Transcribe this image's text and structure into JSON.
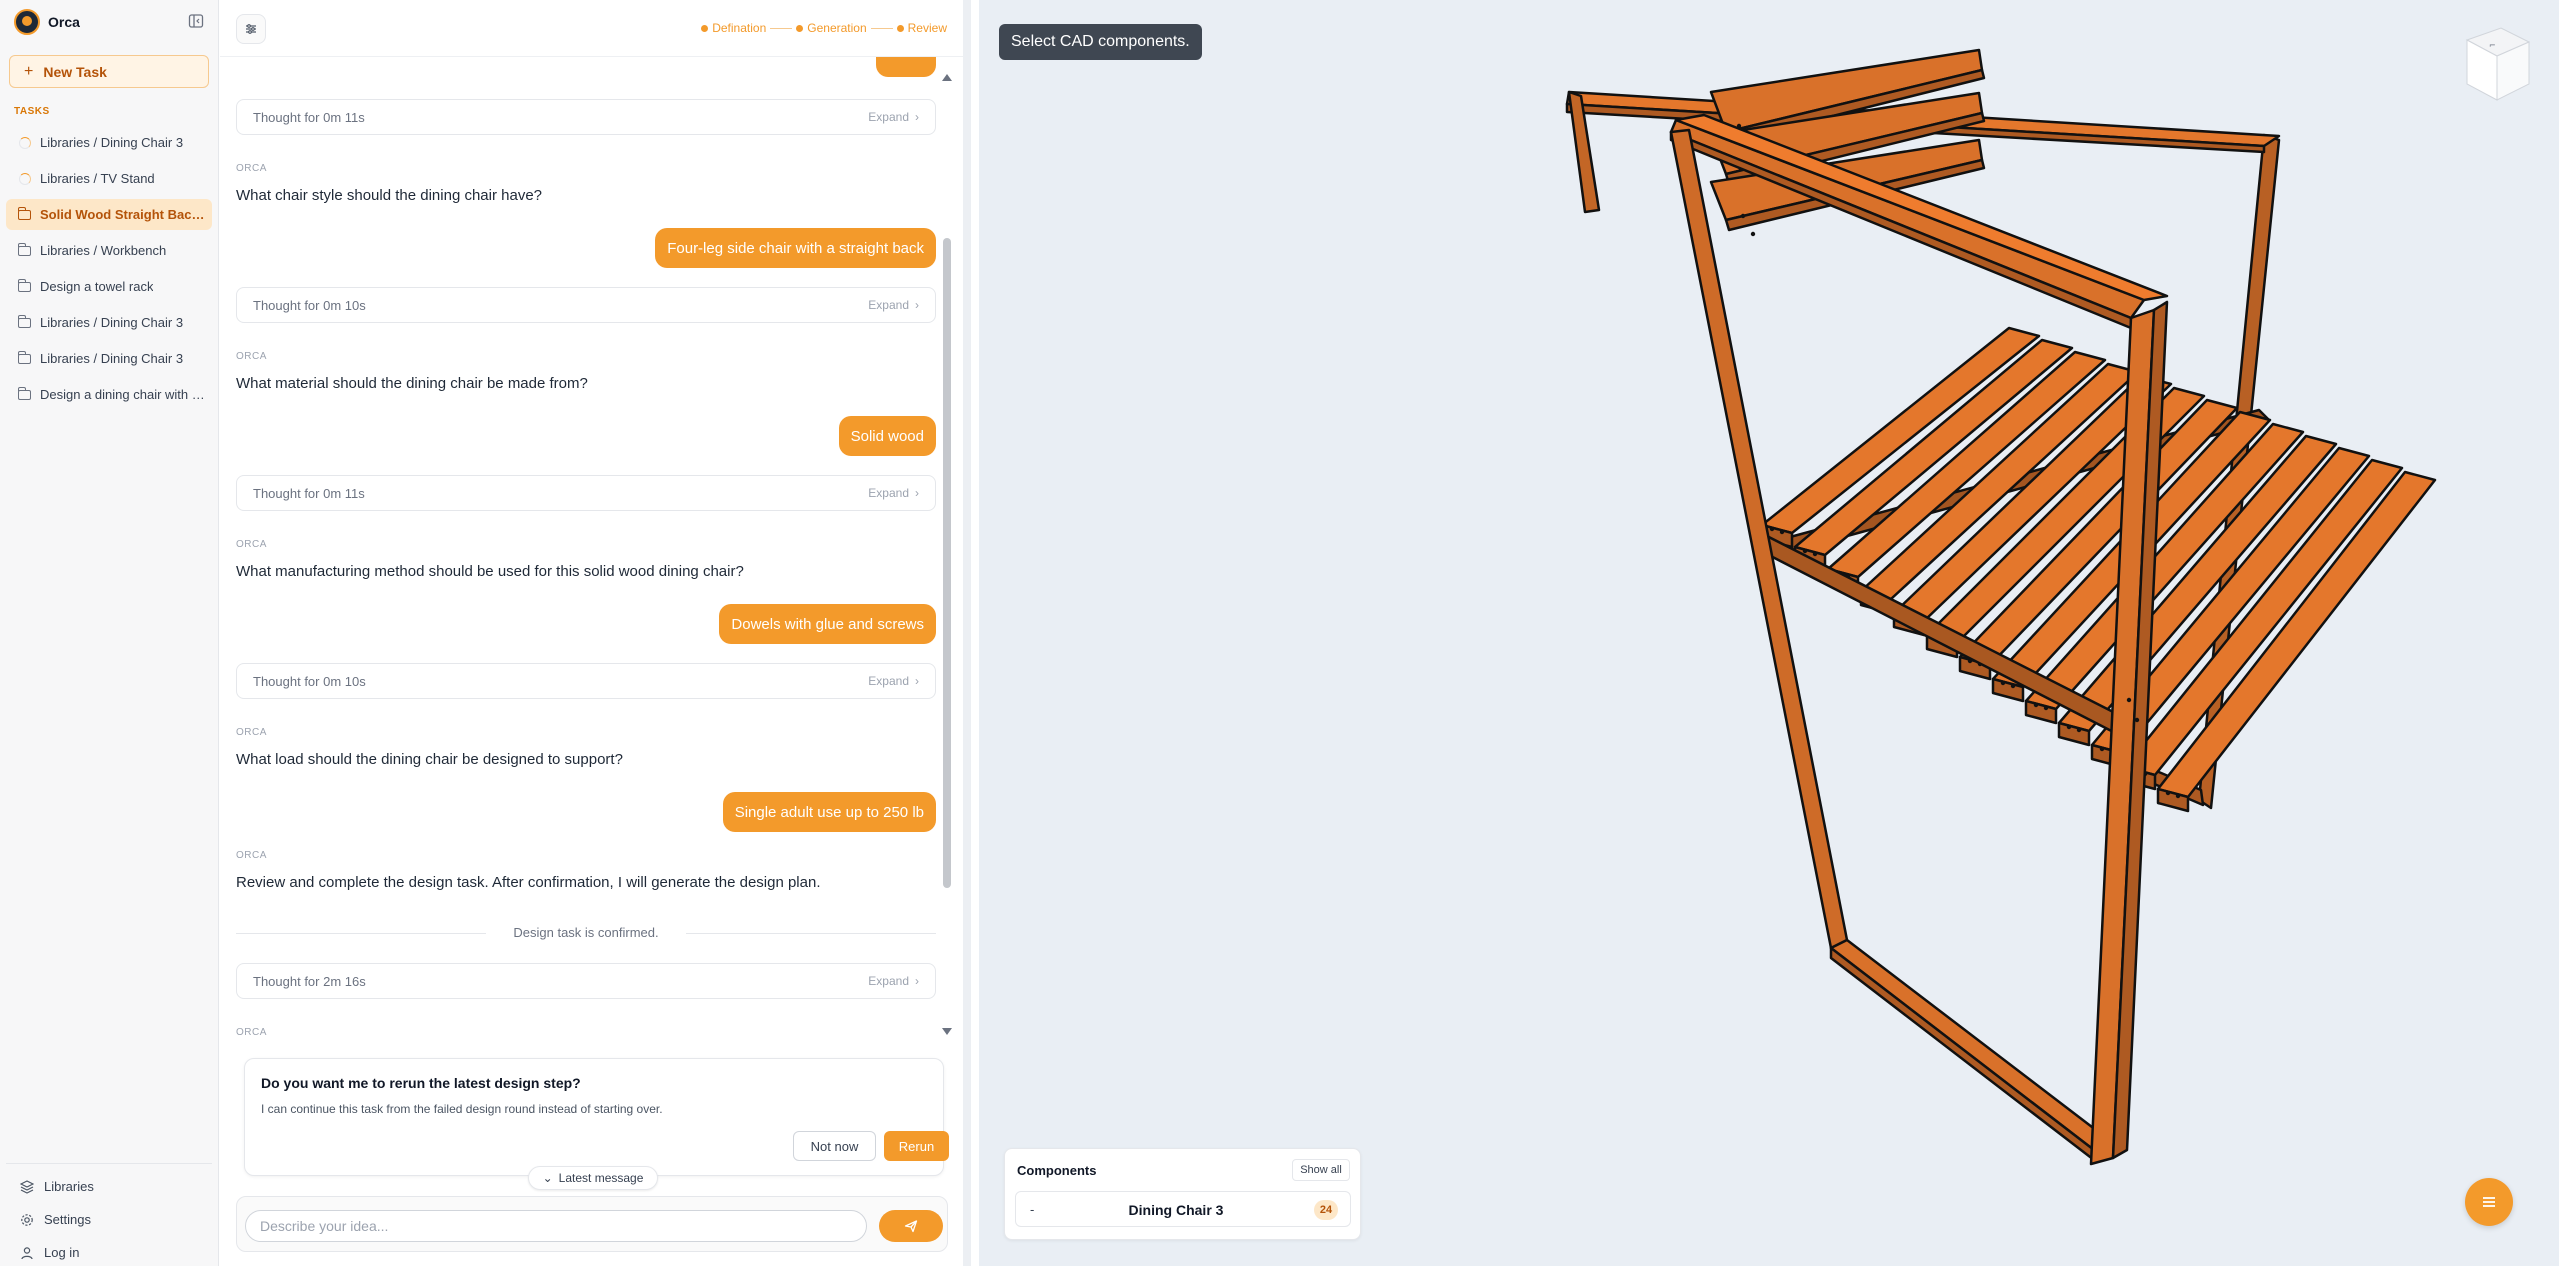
{
  "app": {
    "name": "Orca"
  },
  "sidebar": {
    "new_task_label": "New Task",
    "tasks_title": "TASKS",
    "tasks": [
      {
        "label": "Libraries / Dining Chair 3",
        "icon": "spinner-icon",
        "active": false
      },
      {
        "label": "Libraries / TV Stand",
        "icon": "spinner-icon",
        "active": false
      },
      {
        "label": "Solid Wood Straight Back ...",
        "icon": "folder-icon",
        "active": true
      },
      {
        "label": "Libraries / Workbench",
        "icon": "folder-icon",
        "active": false
      },
      {
        "label": "Design a towel rack",
        "icon": "folder-icon",
        "active": false
      },
      {
        "label": "Libraries / Dining Chair 3",
        "icon": "folder-icon",
        "active": false
      },
      {
        "label": "Libraries / Dining Chair 3",
        "icon": "folder-icon",
        "active": false
      },
      {
        "label": "Design a dining chair with f...",
        "icon": "folder-icon",
        "active": false
      }
    ],
    "bottom": [
      {
        "label": "Libraries",
        "icon": "layers-icon"
      },
      {
        "label": "Settings",
        "icon": "gear-icon"
      },
      {
        "label": "Log in",
        "icon": "user-icon"
      }
    ]
  },
  "chat": {
    "steps": [
      "Defination",
      "Generation",
      "Review"
    ],
    "thoughts": [
      {
        "text": "Thought for 0m 11s",
        "expand": "Expand"
      },
      {
        "text": "Thought for 0m 10s",
        "expand": "Expand"
      },
      {
        "text": "Thought for 0m 11s",
        "expand": "Expand"
      },
      {
        "text": "Thought for 0m 10s",
        "expand": "Expand"
      },
      {
        "text": "Thought for 2m 16s",
        "expand": "Expand"
      }
    ],
    "orca_tag": "ORCA",
    "questions": [
      "What chair style should the dining chair have?",
      "What material should the dining chair be made from?",
      "What manufacturing method should be used for this solid wood dining chair?",
      "What load should the dining chair be designed to support?",
      "Review and complete the design task. After confirmation, I will generate the design plan."
    ],
    "answers": [
      "Four-leg side chair with a straight back",
      "Solid wood",
      "Dowels with glue and screws",
      "Single adult use up to 250 lb"
    ],
    "confirmed": "Design task is confirmed.",
    "rerun": {
      "title": "Do you want me to rerun the latest design step?",
      "description": "I can continue this task from the failed design round instead of starting over.",
      "not_now": "Not now",
      "rerun": "Rerun"
    },
    "latest_message": "Latest message",
    "composer_placeholder": "Describe your idea..."
  },
  "viewport": {
    "tooltip": "Select CAD components.",
    "wood_color": "#d9712a",
    "components": {
      "title": "Components",
      "show_all": "Show all",
      "item_prefix": "-",
      "item_name": "Dining Chair 3",
      "item_count": "24"
    }
  },
  "colors": {
    "accent": "#f39a2b",
    "accent_light": "#fde7c8",
    "accent_text": "#b45309"
  }
}
